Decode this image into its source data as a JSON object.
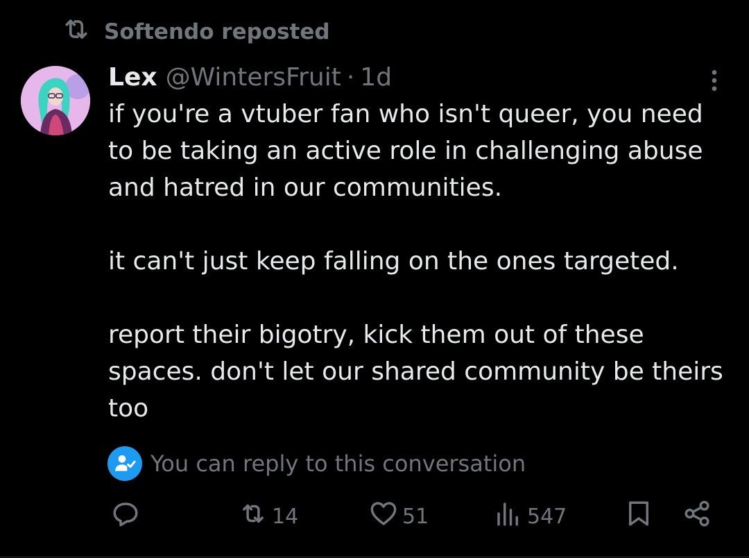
{
  "repost": {
    "label": "Softendo reposted",
    "icon": "repost-icon"
  },
  "author": {
    "name": "Lex",
    "handle": "@WintersFruit",
    "separator": "·",
    "time": "1d"
  },
  "post": {
    "paragraphs": [
      "if you're a vtuber fan who isn't queer, you need to be taking an active role in challenging abuse and hatred in our communities.",
      "it can't just keep falling on the ones targeted.",
      "report their bigotry, kick them out of these spaces. don't let our shared community be theirs too"
    ]
  },
  "reply_note": {
    "text": "You can reply to this conversation",
    "icon": "reply-permission-icon"
  },
  "actions": {
    "reply": {
      "icon": "reply-icon",
      "count": ""
    },
    "repost": {
      "icon": "repost-icon",
      "count": "14"
    },
    "like": {
      "icon": "heart-icon",
      "count": "51"
    },
    "views": {
      "icon": "views-icon",
      "count": "547"
    },
    "bookmark": {
      "icon": "bookmark-icon"
    },
    "share": {
      "icon": "share-icon"
    }
  },
  "colors": {
    "background": "#000000",
    "text": "#e7e9ea",
    "muted": "#71767b",
    "accent": "#1d9bf0"
  }
}
